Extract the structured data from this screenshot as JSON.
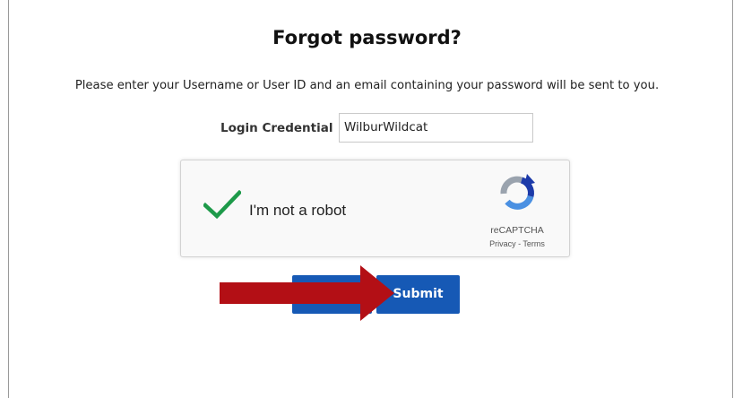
{
  "page": {
    "title": "Forgot password?",
    "instructions": "Please enter your Username or User ID and an email containing your password will be sent to you."
  },
  "form": {
    "credential_label": "Login Credential",
    "credential_value": "WilburWildcat"
  },
  "captcha": {
    "label": "I'm not a robot",
    "checked": true,
    "brand": "reCAPTCHA",
    "links": "Privacy - Terms",
    "check_color": "#1e9a4a",
    "icons": [
      "checkmark-icon",
      "recaptcha-logo-icon"
    ]
  },
  "buttons": {
    "submit_label": "Submit",
    "back_label": ""
  },
  "annotation": {
    "arrow_color": "#b30f15",
    "icon": "red-arrow-annotation"
  },
  "colors": {
    "button_blue": "#1659b5"
  }
}
